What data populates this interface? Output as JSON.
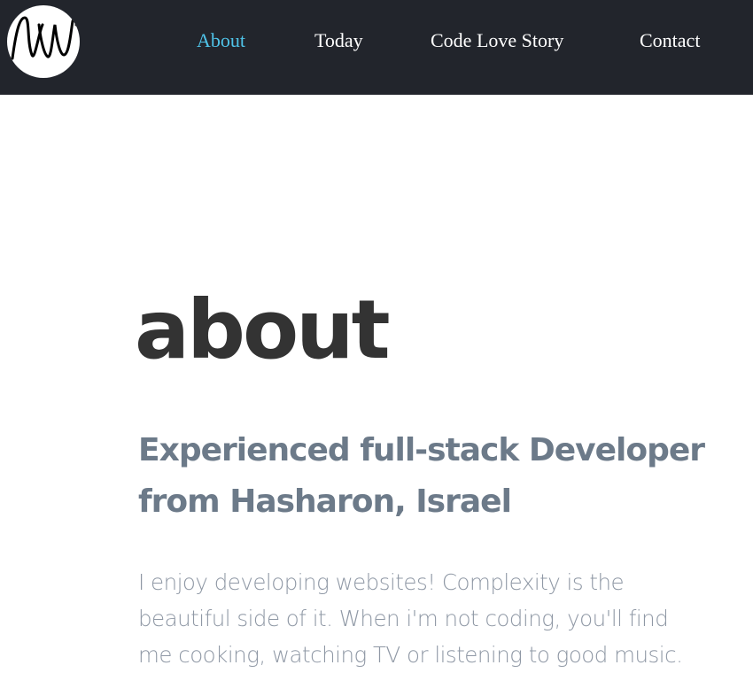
{
  "logo": {
    "text": "NW",
    "icon": "nw-monogram-logo"
  },
  "nav": {
    "items": [
      {
        "label": "About",
        "active": true
      },
      {
        "label": "Today",
        "active": false
      },
      {
        "label": "Code Love Story",
        "active": false
      },
      {
        "label": "Contact",
        "active": false
      }
    ],
    "active_color": "#4fc3e8",
    "background": "#22252c"
  },
  "about": {
    "heading": "about",
    "subtitle": "Experienced full-stack Developer from Hasharon, Israel",
    "description": "I enjoy developing websites! Complexity is the beautiful side of it. When i'm not coding, you'll find me cooking, watching TV or listening to good music."
  }
}
